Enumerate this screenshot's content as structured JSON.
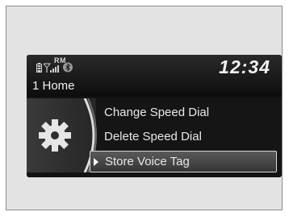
{
  "status": {
    "roam_label": "RM",
    "clock": "12:34",
    "icons": [
      "phone-battery-icon",
      "signal-strength-icon",
      "bluetooth-icon"
    ]
  },
  "header": {
    "title": "1 Home"
  },
  "menu": {
    "items": [
      {
        "label": "Change Speed Dial",
        "selected": false
      },
      {
        "label": "Delete Speed Dial",
        "selected": false
      },
      {
        "label": "Store Voice Tag",
        "selected": true
      }
    ]
  },
  "colors": {
    "screen_bg": "#131313",
    "panel_bg": "#e3e3e3",
    "text": "#f0f0f0",
    "highlight_border": "#d8d8d8"
  }
}
